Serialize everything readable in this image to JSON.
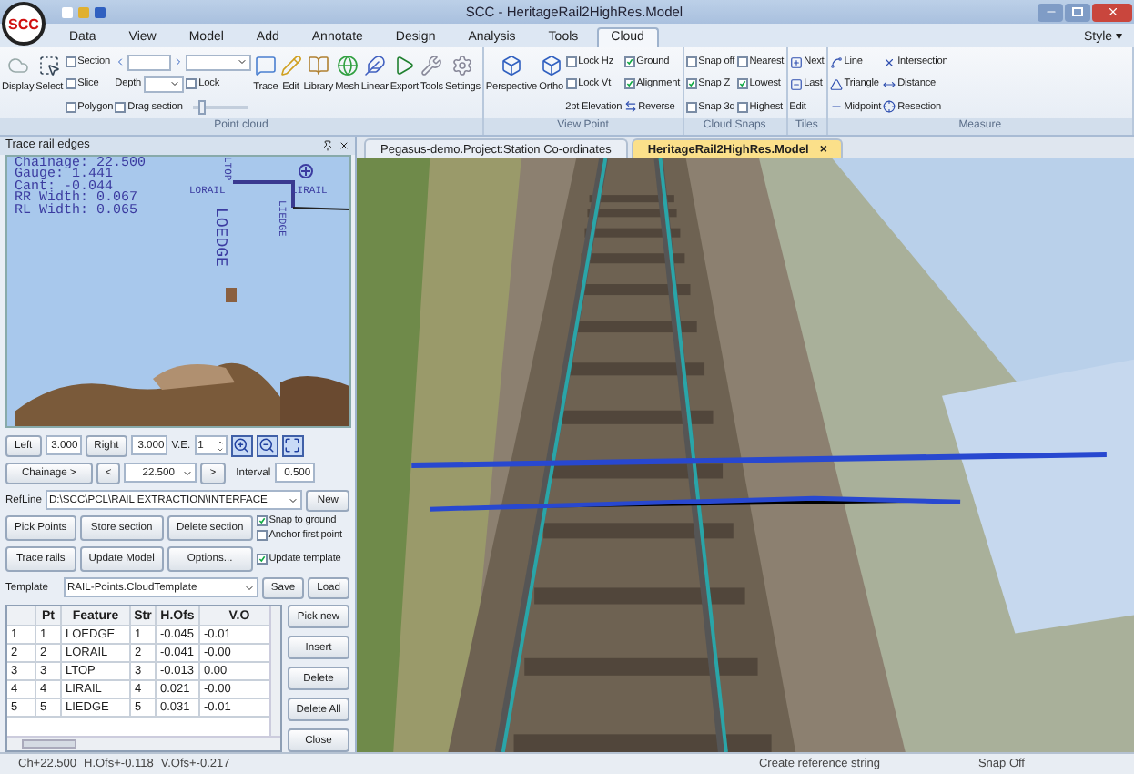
{
  "window": {
    "logo": "SCC",
    "title": "SCC - HeritageRail2HighRes.Model"
  },
  "menu_tabs": [
    {
      "label": "Data",
      "selected": false
    },
    {
      "label": "View",
      "selected": false
    },
    {
      "label": "Model",
      "selected": false
    },
    {
      "label": "Add",
      "selected": false
    },
    {
      "label": "Annotate",
      "selected": false
    },
    {
      "label": "Design",
      "selected": false
    },
    {
      "label": "Analysis",
      "selected": false
    },
    {
      "label": "Tools",
      "selected": false
    },
    {
      "label": "Cloud",
      "selected": true
    }
  ],
  "style_menu": {
    "label": "Style",
    "caret": "▾"
  },
  "ribbon": [
    {
      "label": "Point cloud",
      "columns": [
        [
          {
            "kind": "big",
            "label": "Display"
          }
        ],
        [
          {
            "kind": "big",
            "label": "Select"
          }
        ],
        [
          {
            "kind": "check",
            "label": "Section",
            "checked": false
          },
          {
            "kind": "check",
            "label": "Slice",
            "checked": false
          },
          {
            "kind": "check",
            "label": "Polygon",
            "checked": false
          }
        ],
        [
          {
            "kind": "spin"
          },
          {
            "kind": "combo",
            "label": "Depth"
          },
          {
            "kind": "check",
            "label": "Drag section",
            "checked": false
          }
        ],
        [
          {
            "kind": "combo"
          },
          {
            "kind": "check",
            "label": "Lock",
            "checked": false
          },
          {
            "kind": "slider",
            "level": 0.1
          }
        ],
        [
          {
            "kind": "big",
            "label": "Trace"
          }
        ],
        [
          {
            "kind": "big",
            "label": "Edit"
          }
        ],
        [
          {
            "kind": "big",
            "label": "Library"
          }
        ],
        [
          {
            "kind": "big",
            "label": "Mesh"
          }
        ],
        [
          {
            "kind": "big",
            "label": "Linear"
          }
        ],
        [
          {
            "kind": "big",
            "label": "Export"
          }
        ],
        [
          {
            "kind": "big",
            "label": "Tools"
          }
        ],
        [
          {
            "kind": "big",
            "label": "Settings"
          }
        ]
      ]
    },
    {
      "label": "View Point",
      "columns": [
        [
          {
            "kind": "big",
            "label": "Perspective"
          }
        ],
        [
          {
            "kind": "big",
            "label": "Ortho"
          }
        ],
        [
          {
            "kind": "check",
            "label": "Lock Hz",
            "checked": false
          },
          {
            "kind": "check",
            "label": "Lock Vt",
            "checked": false
          },
          {
            "kind": "text",
            "label": "2pt Elevation"
          }
        ],
        [
          {
            "kind": "check",
            "label": "Ground",
            "checked": true
          },
          {
            "kind": "check",
            "label": "Alignment",
            "checked": true
          },
          {
            "kind": "tool",
            "label": "Reverse"
          }
        ]
      ]
    },
    {
      "label": "Cloud Snaps",
      "columns": [
        [
          {
            "kind": "check",
            "label": "Snap off",
            "checked": false
          },
          {
            "kind": "check",
            "label": "Snap Z",
            "checked": true
          },
          {
            "kind": "check",
            "label": "Snap 3d",
            "checked": false
          }
        ],
        [
          {
            "kind": "check",
            "label": "Nearest",
            "checked": false
          },
          {
            "kind": "check",
            "label": "Lowest",
            "checked": true
          },
          {
            "kind": "check",
            "label": "Highest",
            "checked": false
          }
        ]
      ]
    },
    {
      "label": "Tiles",
      "columns": [
        [
          {
            "kind": "tool",
            "label": "Next"
          },
          {
            "kind": "tool",
            "label": "Last"
          },
          {
            "kind": "text",
            "label": "Edit"
          }
        ]
      ]
    },
    {
      "label": "Measure",
      "columns": [
        [
          {
            "kind": "tool",
            "label": "Line"
          },
          {
            "kind": "tool",
            "label": "Triangle"
          },
          {
            "kind": "tool",
            "label": "Midpoint"
          }
        ],
        [
          {
            "kind": "tool",
            "label": "Intersection"
          },
          {
            "kind": "tool",
            "label": "Distance"
          },
          {
            "kind": "tool",
            "label": "Resection"
          }
        ]
      ]
    }
  ],
  "panel": {
    "title": "Trace rail edges",
    "readouts": [
      "Chainage: 22.500",
      "Gauge: 1.441",
      "Cant: -0.044",
      "RR Width: 0.067",
      "RL Width: 0.065"
    ],
    "labels": [
      {
        "text": "LOEDGE",
        "vertical": true
      },
      {
        "text": "LORAIL",
        "vertical": false
      },
      {
        "text": "LTOP",
        "vertical": true
      },
      {
        "text": "LIRAIL",
        "vertical": false
      },
      {
        "text": "LIEDGE",
        "vertical": true
      }
    ],
    "offsets": {
      "left_label": "Left",
      "left_value": "3.000",
      "right_label": "Right",
      "right_value": "3.000",
      "ve_label": "V.E.",
      "ve_value": "1"
    },
    "chainage": {
      "button": "Chainage >",
      "prev": "<",
      "value": "22.500",
      "next": ">",
      "interval_label": "Interval",
      "interval_value": "0.500"
    },
    "refline": {
      "label": "RefLine",
      "value": "D:\\SCC\\PCL\\RAIL EXTRACTION\\INTERFACE",
      "button": "New"
    },
    "actions": [
      "Pick Points",
      "Store section",
      "Delete section",
      "Trace rails",
      "Update Model",
      "Options..."
    ],
    "options": [
      {
        "label": "Snap to ground",
        "checked": true
      },
      {
        "label": "Anchor first point",
        "checked": false
      },
      {
        "label": "Update template",
        "checked": true
      }
    ],
    "template": {
      "label": "Template",
      "value": "RAIL-Points.CloudTemplate",
      "buttons": [
        "Save",
        "Load"
      ]
    },
    "table": {
      "columns": [
        "Pt",
        "Feature",
        "Str",
        "H.Ofs",
        "V.O"
      ],
      "rows": [
        {
          "row": "1",
          "cells": [
            "1",
            "LOEDGE",
            "1",
            "-0.045",
            "-0.01"
          ]
        },
        {
          "row": "2",
          "cells": [
            "2",
            "LORAIL",
            "2",
            "-0.041",
            "-0.00"
          ]
        },
        {
          "row": "3",
          "cells": [
            "3",
            "LTOP",
            "3",
            "-0.013",
            "0.00"
          ]
        },
        {
          "row": "4",
          "cells": [
            "4",
            "LIRAIL",
            "4",
            "0.021",
            "-0.00"
          ]
        },
        {
          "row": "5",
          "cells": [
            "5",
            "LIEDGE",
            "5",
            "0.031",
            "-0.01"
          ]
        }
      ]
    },
    "table_buttons": [
      "Pick new",
      "Insert",
      "Delete",
      "Delete All",
      "Close"
    ]
  },
  "document_tabs": {
    "close": "×",
    "items": [
      {
        "label": "Pegasus-demo.Project:Station Co-ordinates",
        "selected": false
      },
      {
        "label": "HeritageRail2HighRes.Model",
        "selected": true
      }
    ]
  },
  "status_bar": {
    "readings": [
      "Ch+22.500",
      "H.Ofs+-0.118",
      "V.Ofs+-0.217"
    ],
    "message": "Create reference string",
    "snap": "Snap Off"
  }
}
